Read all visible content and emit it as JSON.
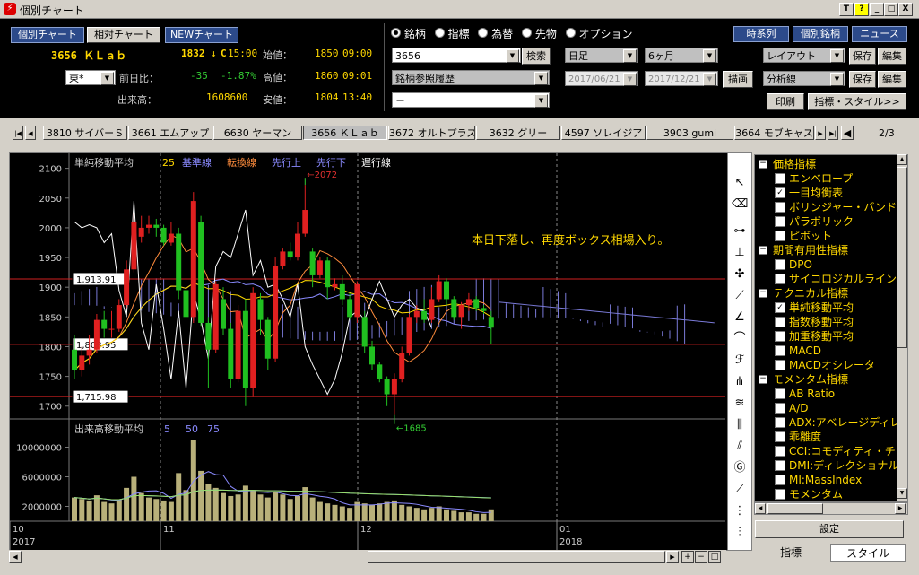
{
  "window": {
    "title": "個別チャート",
    "btn_t": "T",
    "btn_help": "?",
    "btn_min": "_",
    "btn_max": "□",
    "btn_close": "X"
  },
  "top_tabs": [
    "個別チャート",
    "相対チャート",
    "NEWチャート"
  ],
  "stock": {
    "code_name": "3656 ＫＬａｂ",
    "market": "東*",
    "last_price": "1832",
    "arrow": "↓",
    "c_label": "C",
    "last_time": "15:00",
    "prev_diff_label": "前日比：",
    "prev_diff": "-35",
    "prev_diff_pct": "-1.87%",
    "volume_label": "出来高：",
    "volume": "1608600",
    "open_label": "始値：",
    "open_value": "1850",
    "open_time": "09:00",
    "high_label": "高値：",
    "high_value": "1860",
    "high_time": "09:01",
    "low_label": "安値：",
    "low_value": "1804",
    "low_time": "13:40"
  },
  "radios": [
    {
      "label": "銘柄",
      "on": true
    },
    {
      "label": "指標",
      "on": false
    },
    {
      "label": "為替",
      "on": false
    },
    {
      "label": "先物",
      "on": false
    },
    {
      "label": "オプション",
      "on": false
    }
  ],
  "search": {
    "value": "3656",
    "button": "検索",
    "history": "銘柄参照履歴",
    "blank": "－"
  },
  "period": {
    "interval": "日足",
    "range": "6ヶ月",
    "from": "2017/06/21",
    "to": "2017/12/21",
    "draw": "描画"
  },
  "right_buttons": {
    "timeseries": "時系列",
    "individual": "個別銘柄",
    "news": "ニュース",
    "layout": "レイアウト",
    "analysis": "分析線",
    "save": "保存",
    "edit": "編集",
    "print": "印刷",
    "style": "指標・スタイル>>"
  },
  "stock_tabs": [
    "3810 サイバーＳ",
    "3661 エムアップ",
    "6630 ヤーマン",
    "3656 ＫＬａｂ",
    "3672 オルトプラス",
    "3632 グリー",
    "4597 ソレイジア",
    "3903 gumi",
    "3664 モブキャス"
  ],
  "stock_tabs_selected": 3,
  "page_indicator": "2/3",
  "chart": {
    "legend_main": [
      {
        "label": "単純移動平均",
        "color": "#d0d0d0"
      },
      {
        "label": "25",
        "color": "#ffd800"
      },
      {
        "label": "基準線",
        "color": "#8a8aff"
      },
      {
        "label": "転換線",
        "color": "#ff8c3c"
      },
      {
        "label": "先行上",
        "color": "#8a8aff"
      },
      {
        "label": "先行下",
        "color": "#8a8aff"
      },
      {
        "label": "遅行線",
        "color": "#ffffff"
      }
    ],
    "legend_vol": [
      {
        "label": "出来高移動平均",
        "color": "#d0d0d0"
      },
      {
        "label": "5",
        "color": "#8a8aff"
      },
      {
        "label": "50",
        "color": "#8a8aff"
      },
      {
        "label": "75",
        "color": "#8a8aff"
      }
    ],
    "annotation": "本日下落し、再度ボックス相場入り。",
    "price_ticks": [
      "2100",
      "2050",
      "2000",
      "1950",
      "1900",
      "1850",
      "1800",
      "1750",
      "1700"
    ],
    "vol_ticks": [
      "10000000",
      "6000000",
      "2000000"
    ],
    "hlines": [
      {
        "label": "1,913.91",
        "value": 1913.91
      },
      {
        "label": "1,803.95",
        "value": 1803.95
      },
      {
        "label": "1,715.98",
        "value": 1715.98
      }
    ],
    "high_mark": "←2072",
    "low_mark": "←1685",
    "x_months": [
      "10",
      "11",
      "12",
      "01"
    ],
    "x_years": [
      "2017",
      "2018"
    ]
  },
  "chart_data": {
    "type": "candlestick",
    "price_range": [
      1680,
      2110
    ],
    "volume_range": [
      0,
      12000000
    ],
    "candles": [
      [
        1795,
        1760,
        1820,
        1745
      ],
      [
        1760,
        1785,
        1800,
        1750
      ],
      [
        1785,
        1795,
        1820,
        1770
      ],
      [
        1795,
        1845,
        1855,
        1790
      ],
      [
        1845,
        1830,
        1860,
        1815
      ],
      [
        1830,
        1830,
        1860,
        1815
      ],
      [
        1830,
        1870,
        1880,
        1825
      ],
      [
        1870,
        1930,
        1945,
        1865
      ],
      [
        1930,
        2010,
        2025,
        1925
      ],
      [
        1985,
        2000,
        2020,
        1975
      ],
      [
        2000,
        2005,
        2020,
        1990
      ],
      [
        2005,
        2000,
        2015,
        1985
      ],
      [
        2000,
        1975,
        2005,
        1970
      ],
      [
        1975,
        1990,
        2010,
        1970
      ],
      [
        1990,
        1895,
        2000,
        1880
      ],
      [
        1895,
        1850,
        1905,
        1840
      ],
      [
        1850,
        2045,
        2060,
        1840
      ],
      [
        2010,
        1840,
        2020,
        1835
      ],
      [
        1840,
        1795,
        1850,
        1730
      ],
      [
        1795,
        1905,
        1910,
        1790
      ],
      [
        1880,
        1830,
        1900,
        1820
      ],
      [
        1830,
        1745,
        1840,
        1730
      ],
      [
        1745,
        1860,
        1870,
        1740
      ],
      [
        1860,
        1730,
        1880,
        1700
      ],
      [
        1730,
        1890,
        1900,
        1715
      ],
      [
        1880,
        1845,
        1890,
        1820
      ],
      [
        1845,
        1780,
        1850,
        1760
      ],
      [
        1780,
        1935,
        1950,
        1775
      ],
      [
        1935,
        1960,
        1965,
        1930
      ],
      [
        1960,
        1950,
        1975,
        1945
      ],
      [
        1950,
        1990,
        2010,
        1945
      ],
      [
        1990,
        2030,
        2072,
        1985
      ],
      [
        1960,
        1920,
        1965,
        1900
      ],
      [
        1920,
        1945,
        1950,
        1915
      ],
      [
        1945,
        1900,
        1950,
        1880
      ],
      [
        1900,
        1905,
        1915,
        1895
      ],
      [
        1905,
        1880,
        1920,
        1870
      ],
      [
        1880,
        1850,
        1890,
        1845
      ],
      [
        1850,
        1905,
        1910,
        1840
      ],
      [
        1850,
        1800,
        1860,
        1790
      ],
      [
        1800,
        1770,
        1810,
        1760
      ],
      [
        1770,
        1745,
        1775,
        1740
      ],
      [
        1745,
        1720,
        1750,
        1700
      ],
      [
        1720,
        1745,
        1755,
        1685
      ],
      [
        1745,
        1790,
        1800,
        1740
      ],
      [
        1790,
        1850,
        1855,
        1785
      ],
      [
        1850,
        1860,
        1870,
        1840
      ],
      [
        1860,
        1845,
        1880,
        1840
      ],
      [
        1845,
        1880,
        1900,
        1840
      ],
      [
        1880,
        1910,
        1920,
        1875
      ],
      [
        1910,
        1880,
        1915,
        1870
      ],
      [
        1880,
        1850,
        1885,
        1845
      ],
      [
        1850,
        1870,
        1875,
        1830
      ],
      [
        1870,
        1880,
        1890,
        1860
      ],
      [
        1880,
        1865,
        1885,
        1860
      ],
      [
        1865,
        1860,
        1870,
        1855
      ],
      [
        1850,
        1832,
        1860,
        1804
      ]
    ],
    "volume": [
      3.2,
      3.0,
      2.8,
      3.5,
      2.6,
      2.4,
      2.9,
      4.5,
      6.0,
      3.8,
      3.2,
      3.0,
      2.8,
      2.6,
      6.5,
      4.2,
      11.0,
      6.8,
      5.0,
      4.5,
      3.8,
      3.4,
      3.6,
      4.8,
      4.2,
      3.6,
      3.2,
      4.0,
      3.6,
      3.0,
      3.4,
      4.6,
      3.2,
      2.6,
      2.4,
      2.2,
      2.0,
      1.8,
      2.6,
      2.4,
      2.2,
      2.4,
      2.6,
      2.8,
      2.2,
      2.0,
      1.8,
      1.6,
      1.8,
      2.0,
      1.6,
      1.4,
      1.2,
      1.2,
      1.0,
      1.0,
      1.6
    ]
  },
  "indicator_panel": {
    "groups": [
      {
        "label": "価格指標",
        "items": [
          {
            "label": "エンベロープ",
            "on": false
          },
          {
            "label": "一目均衡表",
            "on": true
          },
          {
            "label": "ボリンジャー・バンド",
            "on": false
          },
          {
            "label": "パラボリック",
            "on": false
          },
          {
            "label": "ピボット",
            "on": false
          }
        ]
      },
      {
        "label": "期間有用性指標",
        "items": [
          {
            "label": "DPO",
            "on": false
          },
          {
            "label": "サイコロジカルライン",
            "on": false
          }
        ]
      },
      {
        "label": "テクニカル指標",
        "items": [
          {
            "label": "単純移動平均",
            "on": true
          },
          {
            "label": "指数移動平均",
            "on": false
          },
          {
            "label": "加重移動平均",
            "on": false
          },
          {
            "label": "MACD",
            "on": false
          },
          {
            "label": "MACDオシレータ",
            "on": false
          }
        ]
      },
      {
        "label": "モメンタム指標",
        "items": [
          {
            "label": "AB Ratio",
            "on": false
          },
          {
            "label": "A/D",
            "on": false
          },
          {
            "label": "ADX:アベレージディレクショナル",
            "on": false
          },
          {
            "label": "乖離度",
            "on": false
          },
          {
            "label": "CCI:コモディティ・チャネル",
            "on": false
          },
          {
            "label": "DMI:ディレクショナル",
            "on": false
          },
          {
            "label": "MI:MassIndex",
            "on": false
          },
          {
            "label": "モメンタム",
            "on": false
          }
        ]
      }
    ],
    "settings_button": "設定",
    "tab_indicator": "指標",
    "tab_style": "スタイル"
  }
}
